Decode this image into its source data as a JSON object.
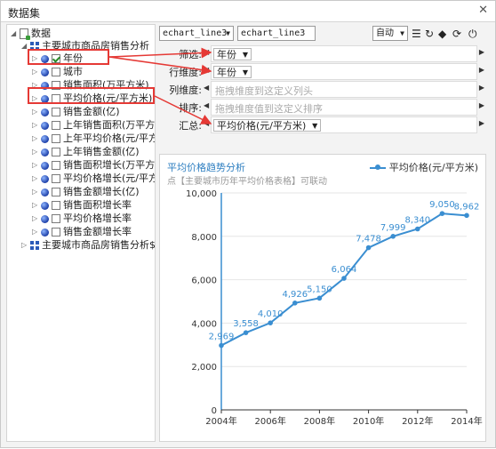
{
  "window": {
    "title": "数据集",
    "close_icon": "close-icon"
  },
  "tree": {
    "root_label": "数据",
    "dataset1_label": "主要城市商品房销售分析",
    "items": [
      {
        "label": "年份",
        "checked": true
      },
      {
        "label": "城市",
        "checked": false
      },
      {
        "label": "销售面积(万平方米)",
        "checked": false
      },
      {
        "label": "平均价格(元/平方米)",
        "checked": false
      },
      {
        "label": "销售金额(亿)",
        "checked": false
      },
      {
        "label": "上年销售面积(万平方米)",
        "checked": false
      },
      {
        "label": "上年平均价格(元/平方米)",
        "checked": false
      },
      {
        "label": "上年销售金额(亿)",
        "checked": false
      },
      {
        "label": "销售面积增长(万平方米)",
        "checked": false
      },
      {
        "label": "平均价格增长(元/平方米)",
        "checked": false
      },
      {
        "label": "销售金额增长(亿)",
        "checked": false
      },
      {
        "label": "销售面积增长率",
        "checked": false
      },
      {
        "label": "平均价格增长率",
        "checked": false
      },
      {
        "label": "销售金额增长率",
        "checked": false
      }
    ],
    "dataset2_label": "主要城市商品房销售分析$R"
  },
  "toolbar": {
    "chart_select": "echart_line3",
    "chart_name": "echart_line3",
    "mode_select": "自动"
  },
  "fields": {
    "filter_label": "筛选:",
    "filter_value": "年份",
    "row_label": "行维度:",
    "row_value": "年份",
    "col_label": "列维度:",
    "col_hint": "拖拽维度到这定义列头",
    "sort_label": "排序:",
    "sort_hint": "拖拽维度值到这定义排序",
    "agg_label": "汇总:",
    "agg_value": "平均价格(元/平方米)"
  },
  "chart": {
    "title": "平均价格趋势分析",
    "subtitle": "点【主要城市历年平均价格表格】可联动",
    "legend": "平均价格(元/平方米)"
  },
  "chart_data": {
    "type": "line",
    "title": "平均价格趋势分析",
    "series": [
      {
        "name": "平均价格(元/平方米)",
        "values": [
          2969,
          3558,
          4010,
          4926,
          5150,
          6064,
          7478,
          7999,
          8340,
          9050,
          8962
        ]
      }
    ],
    "x": [
      2004,
      2005,
      2006,
      2007,
      2008,
      2009,
      2010,
      2011,
      2012,
      2013,
      2014
    ],
    "x_tick_labels": [
      "2004年",
      "2006年",
      "2008年",
      "2010年",
      "2012年",
      "2014年"
    ],
    "x_ticks": [
      2004,
      2006,
      2008,
      2010,
      2012,
      2014
    ],
    "y_ticks": [
      0,
      2000,
      4000,
      6000,
      8000,
      10000
    ],
    "y_tick_labels": [
      "0",
      "2,000",
      "4,000",
      "6,000",
      "8,000",
      "10,000"
    ],
    "data_labels": [
      "2,969",
      "3,558",
      "4,010",
      "4,926",
      "5,150",
      "6,064",
      "7,478",
      "7,999",
      "8,340",
      "9,050",
      "8,962"
    ],
    "ylim": [
      0,
      10000
    ],
    "xlim": [
      2004,
      2014
    ],
    "grid": true,
    "legend_position": "top-right",
    "color": "#3a8ed1"
  }
}
